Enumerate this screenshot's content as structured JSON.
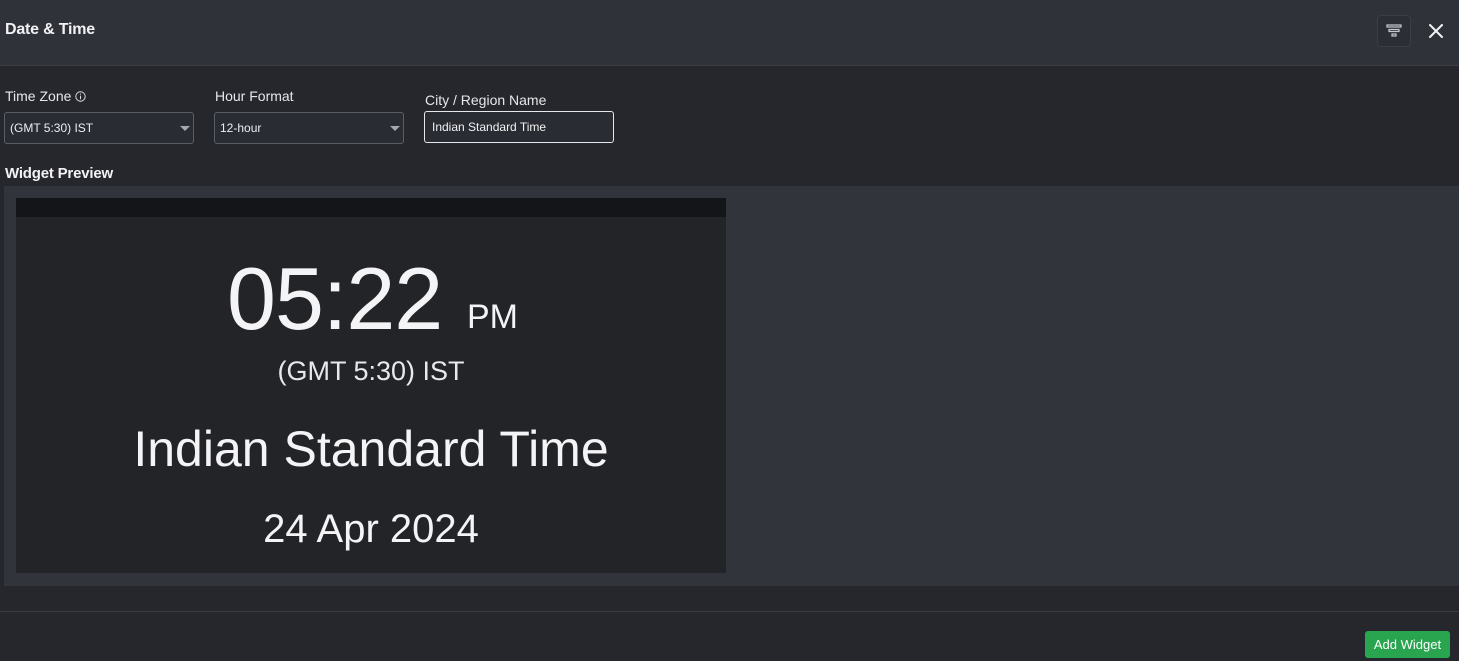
{
  "header": {
    "title": "Date & Time",
    "filter_icon": "filter-icon",
    "close_icon": "close-icon"
  },
  "form": {
    "timezone": {
      "label": "Time Zone",
      "value": "(GMT 5:30) IST",
      "info_icon": "info-icon"
    },
    "hour_format": {
      "label": "Hour Format",
      "value": "12-hour"
    },
    "city": {
      "label": "City / Region Name",
      "value": "Indian Standard Time"
    }
  },
  "preview": {
    "title": "Widget Preview",
    "time": "05:22",
    "ampm": "PM",
    "timezone": "(GMT 5:30) IST",
    "city": "Indian Standard Time",
    "date": "24 Apr 2024"
  },
  "footer": {
    "add_label": "Add Widget"
  },
  "colors": {
    "accent": "#2aa54f",
    "background": "#26272c",
    "header": "#30323a",
    "preview_bg": "#32343c",
    "widget_bg": "#232428"
  }
}
